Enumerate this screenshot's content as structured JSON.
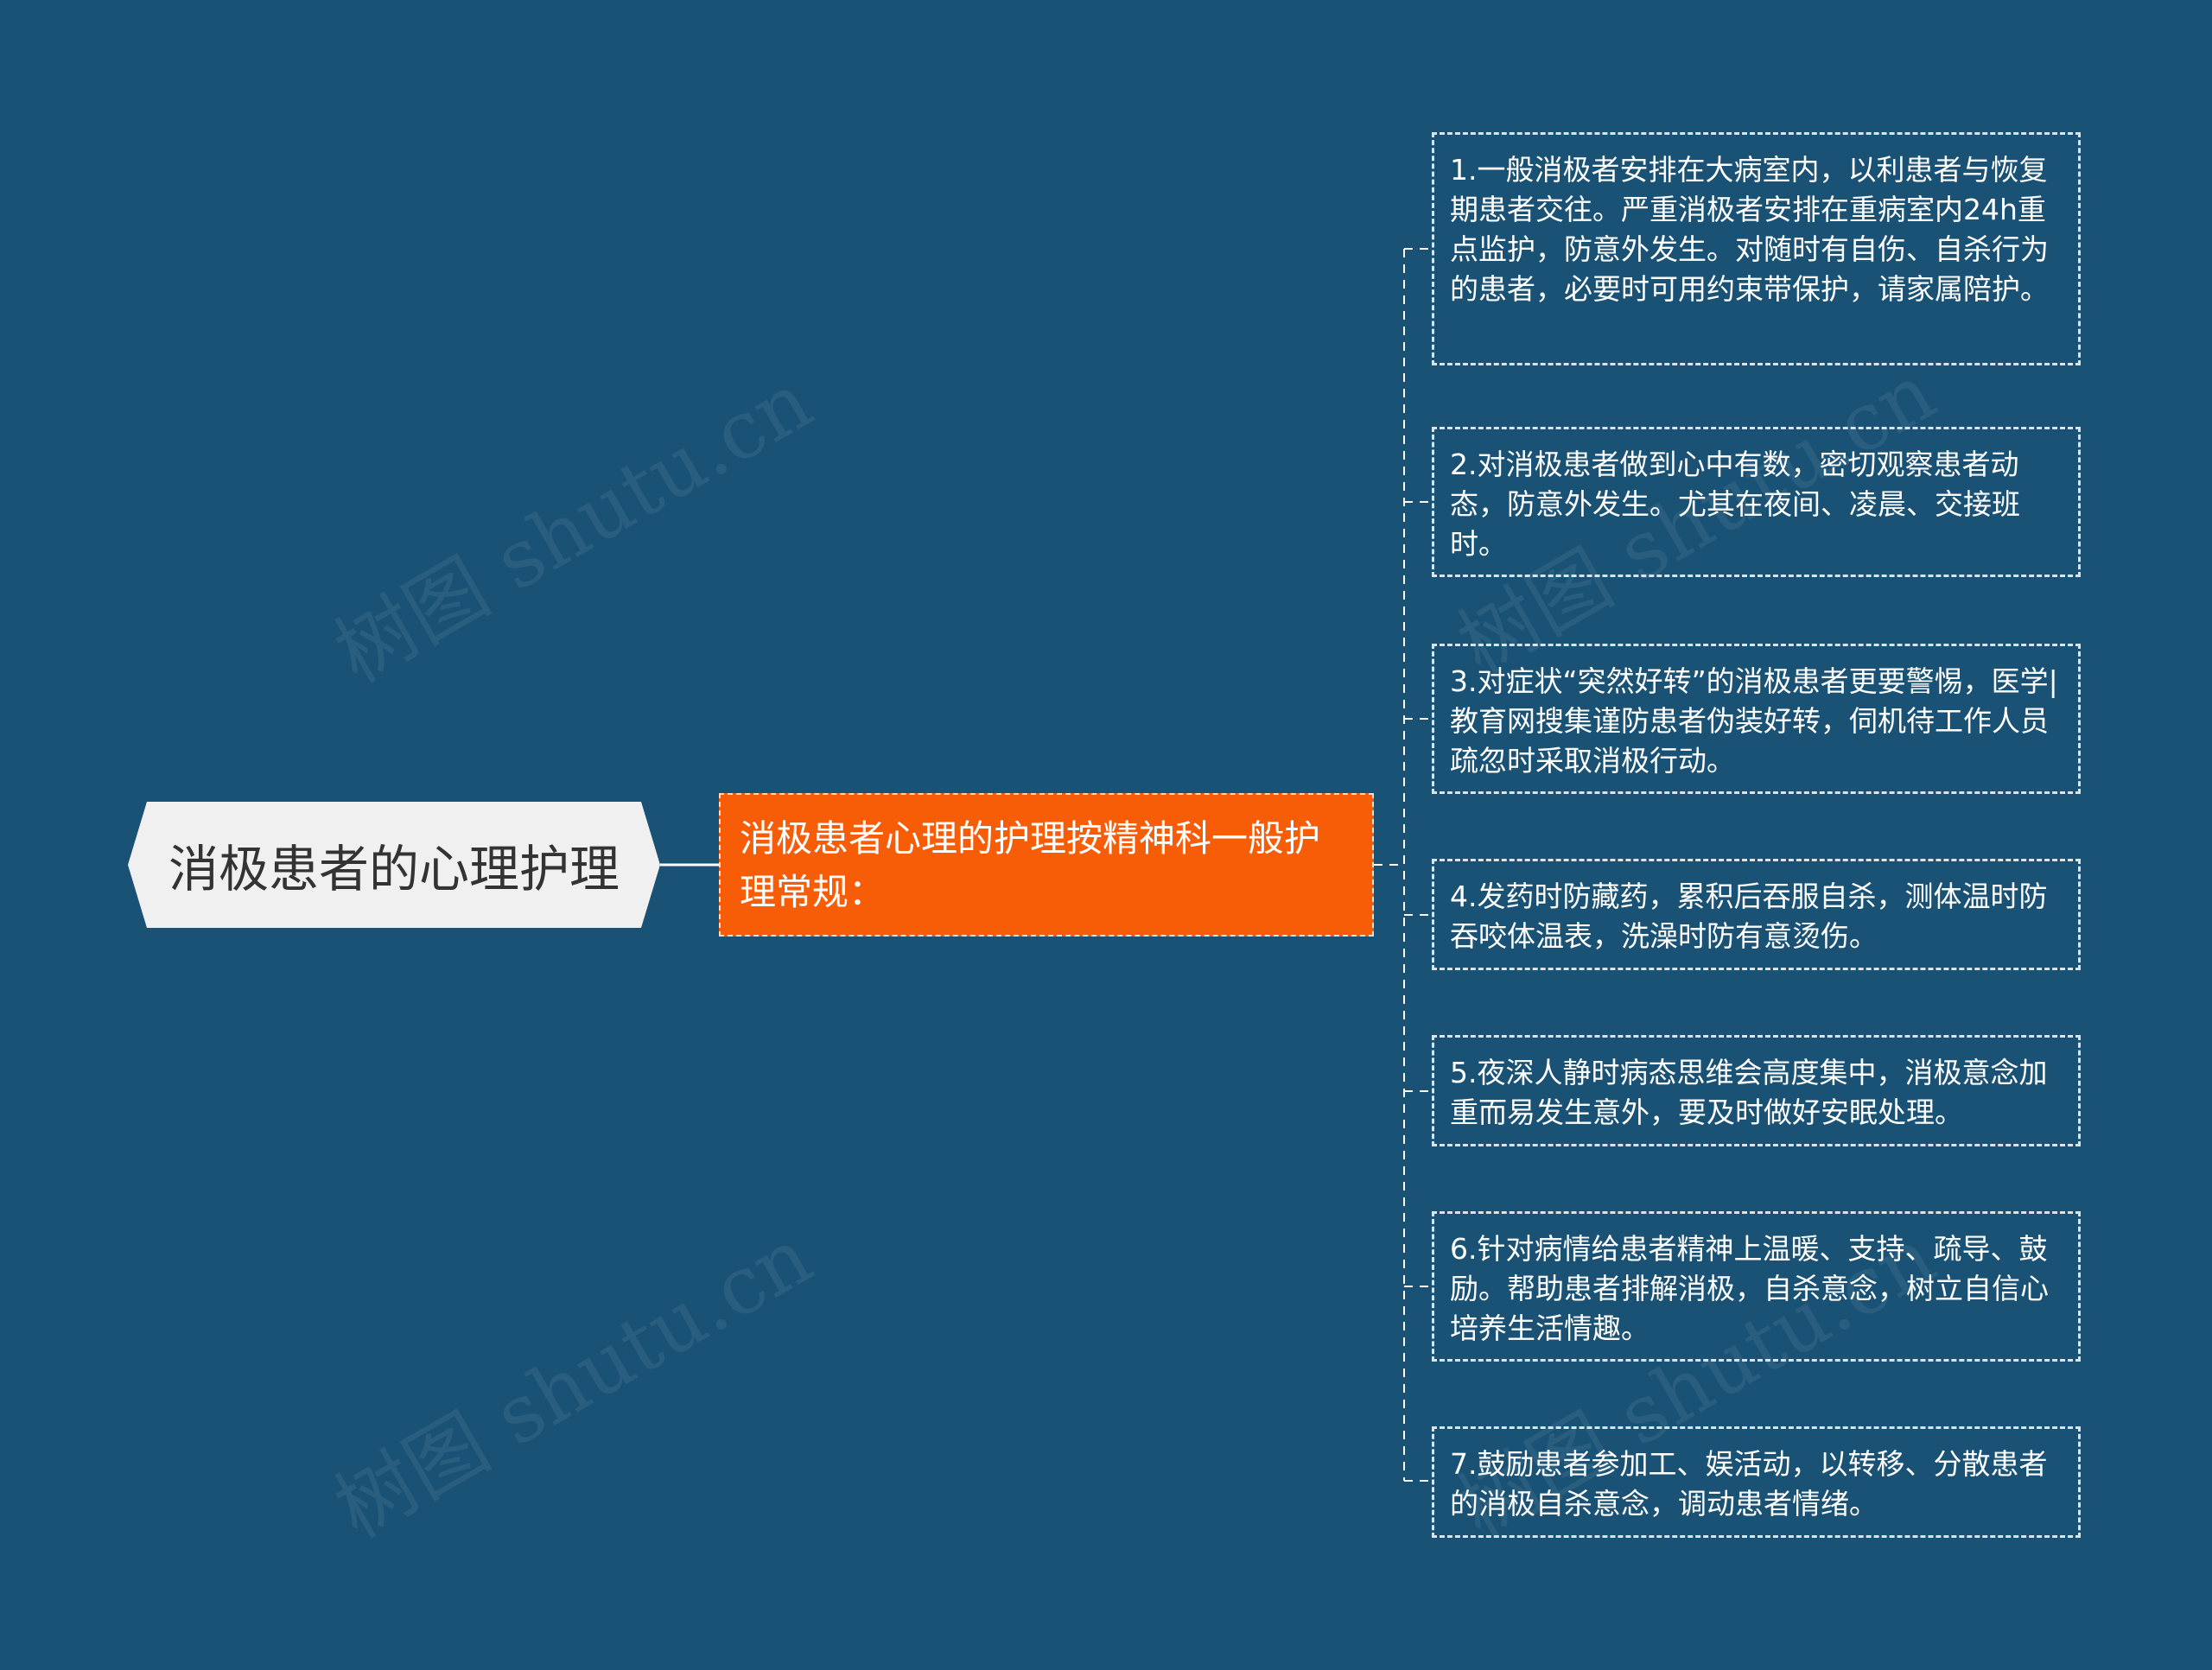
{
  "colors": {
    "background": "#1a5276",
    "root_fill": "#f0f0f0",
    "branch_fill": "#f75c06",
    "connector": "#ffffff"
  },
  "root": {
    "label": "消极患者的心理护理"
  },
  "branch": {
    "label": "消极患者心理的护理按精神科一般护理常规："
  },
  "leaves": [
    {
      "text": "1.一般消极者安排在大病室内，以利患者与恢复期患者交往。严重消极者安排在重病室内24h重点监护，防意外发生。对随时有自伤、自杀行为的患者，必要时可用约束带保护，请家属陪护。"
    },
    {
      "text": "2.对消极患者做到心中有数，密切观察患者动态，防意外发生。尤其在夜间、凌晨、交接班时。"
    },
    {
      "text": "3.对症状“突然好转”的消极患者更要警惕，医学|教育网搜集谨防患者伪装好转，伺机待工作人员疏忽时采取消极行动。"
    },
    {
      "text": "4.发药时防藏药，累积后吞服自杀，测体温时防吞咬体温表，洗澡时防有意烫伤。"
    },
    {
      "text": "5.夜深人静时病态思维会高度集中，消极意念加重而易发生意外，要及时做好安眠处理。"
    },
    {
      "text": "6.针对病情给患者精神上温暖、支持、疏导、鼓励。帮助患者排解消极，自杀意念，树立自信心培养生活情趣。"
    },
    {
      "text": "7.鼓励患者参加工、娱活动，以转移、分散患者的消极自杀意念，调动患者情绪。"
    }
  ],
  "watermarks": [
    "树图 shutu.cn",
    "树图 shutu.cn",
    "树图 shutu.cn",
    "树图 shutu.cn"
  ]
}
